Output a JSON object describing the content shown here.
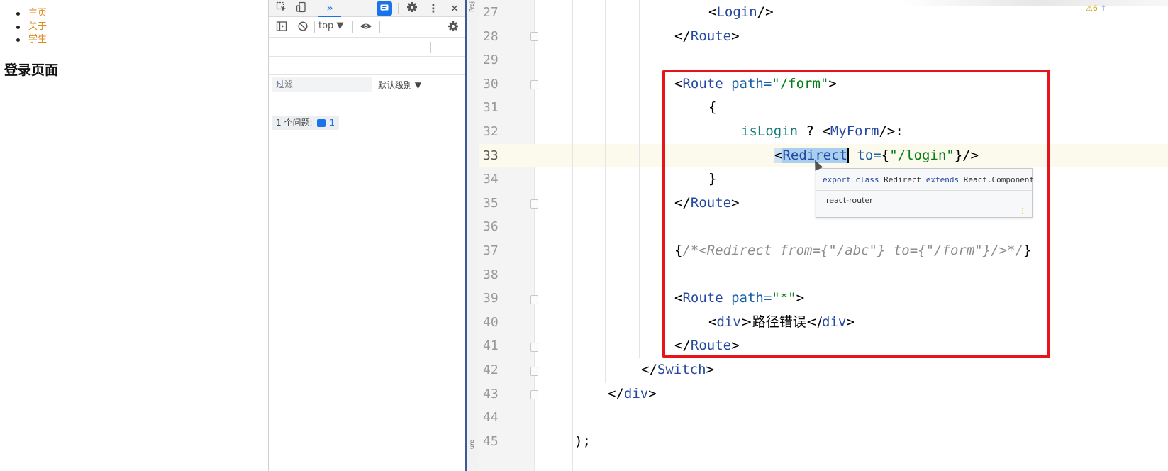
{
  "webpage": {
    "nav": [
      {
        "label": "主页"
      },
      {
        "label": "关于"
      },
      {
        "label": "学生"
      }
    ],
    "heading": "登录页面"
  },
  "devtools": {
    "icons": {
      "inspect": "inspect-icon",
      "device": "device-toggle-icon",
      "more_tabs": "»",
      "issues": "issues-icon",
      "settings": "gear-icon",
      "menu": "⋮",
      "close": "✕",
      "sidebar": "sidebar-icon",
      "clear": "clear-console-icon",
      "eye": "eye-icon"
    },
    "context": "top ▼",
    "filter_placeholder": "过滤",
    "levels": "默认级别 ▼",
    "issues_label": "1 个问题:",
    "issues_count": "1",
    "prompt": "›"
  },
  "ide": {
    "side_label_top": "Proj",
    "side_label_bottom": "ure",
    "warnings": "6",
    "warning_arrow": "↑",
    "lines": [
      {
        "n": "27"
      },
      {
        "n": "28"
      },
      {
        "n": "29"
      },
      {
        "n": "30"
      },
      {
        "n": "31"
      },
      {
        "n": "32"
      },
      {
        "n": "33"
      },
      {
        "n": "34"
      },
      {
        "n": "35"
      },
      {
        "n": "36"
      },
      {
        "n": "37"
      },
      {
        "n": "38"
      },
      {
        "n": "39"
      },
      {
        "n": "40"
      },
      {
        "n": "41"
      },
      {
        "n": "42"
      },
      {
        "n": "43"
      },
      {
        "n": "44"
      },
      {
        "n": "45"
      }
    ],
    "code": {
      "l27": {
        "open": "<",
        "tag": "Login",
        "close": "/>"
      },
      "l28": {
        "open": "</",
        "tag": "Route",
        "close": ">"
      },
      "l30": {
        "open": "<",
        "tag": "Route",
        "attr": " path=",
        "val": "\"/form\"",
        "close": ">"
      },
      "l31": {
        "text": "{"
      },
      "l32": {
        "ident": "isLogin",
        "op": " ? <",
        "comp": "MyForm",
        "close": "/>:"
      },
      "l33": {
        "open": "<",
        "tag_a": "Redi",
        "tag_b": "rect",
        "attr": " to=",
        "brace_open": "{",
        "val": "\"/login\"",
        "close": "}/>"
      },
      "l34": {
        "text": "}"
      },
      "l35": {
        "open": "</",
        "tag": "Route",
        "close": ">"
      },
      "l37": {
        "open": "{",
        "comment": "/*<Redirect from={\"/abc\"} to={\"/form\"}/>*/",
        "close": "}"
      },
      "l39": {
        "open": "<",
        "tag": "Route",
        "attr": " path=",
        "val": "\"*\"",
        "close": ">"
      },
      "l40": {
        "open": "<",
        "tag": "div",
        "mid": ">路径错误</",
        "tag2": "div",
        "close": ">"
      },
      "l41": {
        "open": "</",
        "tag": "Route",
        "close": ">"
      },
      "l42": {
        "open": "</",
        "tag": "Switch",
        "close": ">"
      },
      "l43": {
        "open": "</",
        "tag": "div",
        "close": ">"
      },
      "l45": {
        "text": ");"
      }
    },
    "tooltip": {
      "kw1": "export",
      "kw2": "class",
      "name": "Redirect",
      "kw3": "extends",
      "base": "React.Component",
      "module": "react-router",
      "more": "⋮"
    },
    "colors": {
      "highlight_box": "#e8141c",
      "tag": "#2548a0",
      "string": "#067d17",
      "selection": "#a8cfef"
    }
  }
}
